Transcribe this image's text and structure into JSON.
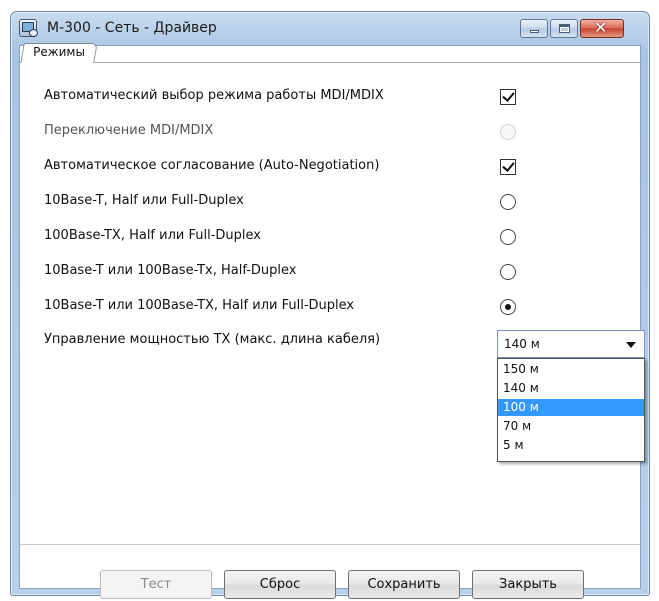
{
  "window": {
    "title": "М-300 - Сеть - Драйвер",
    "tab_label": "Режимы"
  },
  "settings": [
    {
      "label": "Автоматический выбор режима работы MDI/MDIX",
      "control": "checkbox",
      "checked": true,
      "enabled": true
    },
    {
      "label": "Переключение MDI/MDIX",
      "control": "radio",
      "checked": false,
      "enabled": false
    },
    {
      "label": "Автоматическое согласование (Auto-Negotiation)",
      "control": "checkbox",
      "checked": true,
      "enabled": true
    },
    {
      "label": "10Base-T, Half или Full-Duplex",
      "control": "radio",
      "checked": false,
      "enabled": true
    },
    {
      "label": "100Base-TX, Half или Full-Duplex",
      "control": "radio",
      "checked": false,
      "enabled": true
    },
    {
      "label": "10Base-T или 100Base-Tx, Half-Duplex",
      "control": "radio",
      "checked": false,
      "enabled": true
    },
    {
      "label": "10Base-T или 100Base-TX, Half или Full-Duplex",
      "control": "radio",
      "checked": true,
      "enabled": true
    }
  ],
  "tx_power": {
    "label": "Управление мощностью TX (макс. длина кабеля)",
    "selected": "140 м",
    "options": [
      "150 м",
      "140 м",
      "100 м",
      "70 м",
      "5 м"
    ],
    "highlighted": "100 м"
  },
  "buttons": {
    "test": "Тест",
    "reset": "Сброс",
    "save": "Сохранить",
    "close": "Закрыть"
  },
  "colors": {
    "highlight": "#3399ff",
    "titlebar": "#b8d0ea"
  }
}
